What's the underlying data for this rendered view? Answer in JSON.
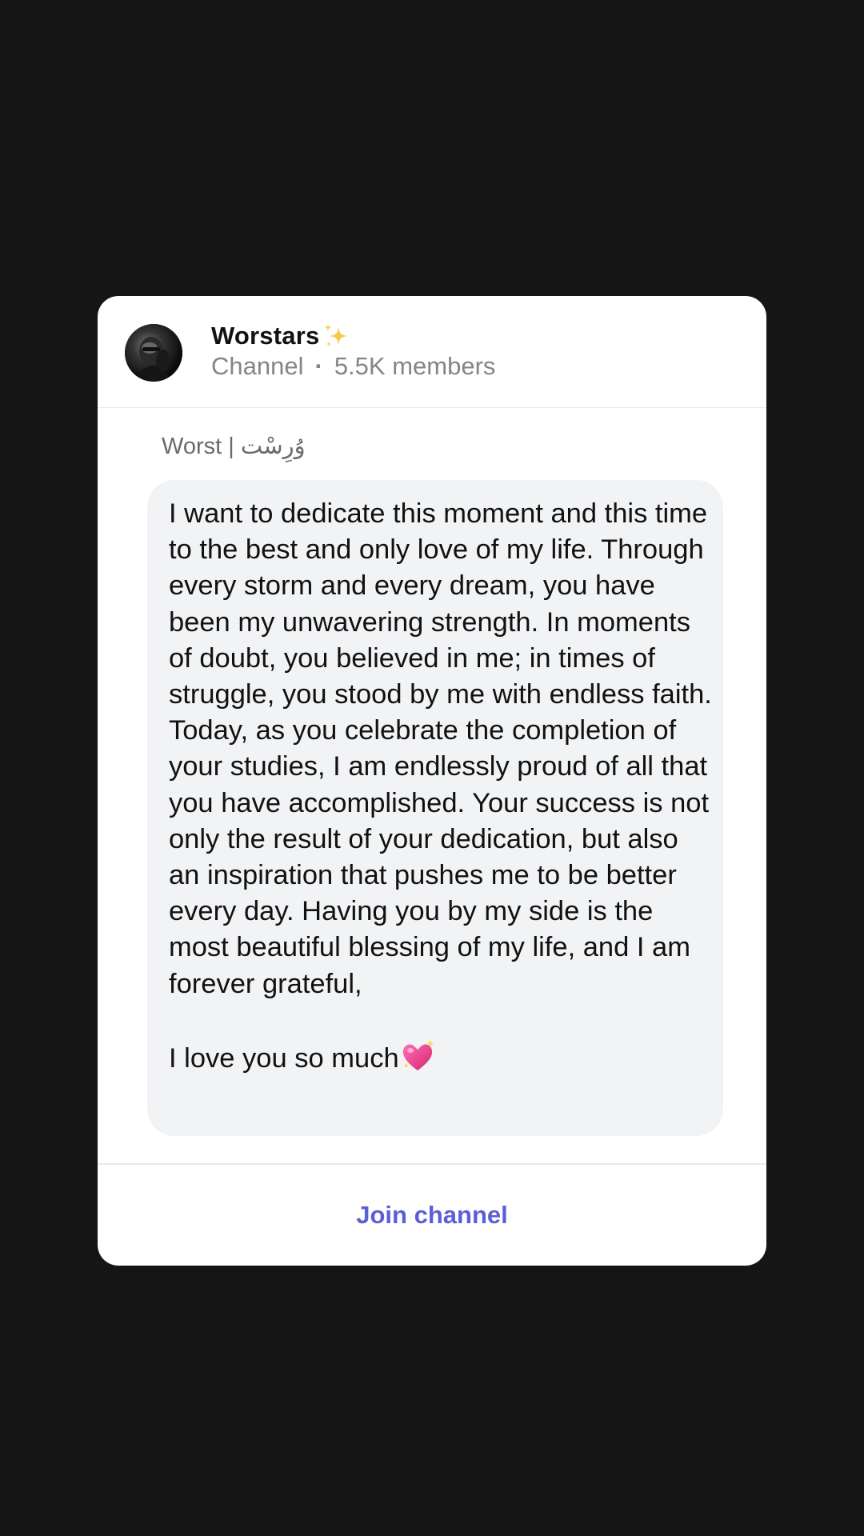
{
  "channel": {
    "name": "Worstars",
    "name_emoji": "sparkles-icon",
    "type_label": "Channel",
    "separator": "·",
    "members": "5.5K members",
    "avatar": "avatar-photo"
  },
  "post": {
    "sender": "Worst | وُرِسْت",
    "text": "I want to dedicate this moment and this time to the best and only love of my life. Through every storm and every dream, you have been my unwavering strength. In moments of doubt, you believed in me; in times of struggle, you stood by me with endless faith. Today, as you celebrate the completion of your studies, I am endlessly proud of all that you have accomplished. Your success is not only the result of your dedication, but also an inspiration that pushes me to be better every day. Having you by my side is the most beautiful blessing of my life, and I am forever grateful,",
    "closing": "I love you so much",
    "closing_emoji": "sparkling-heart-icon"
  },
  "footer": {
    "join_label": "Join channel"
  },
  "colors": {
    "background": "#151515",
    "card": "#ffffff",
    "bubble": "#f2f3f5",
    "accent": "#5b5fd6",
    "secondary_text": "#848489"
  }
}
